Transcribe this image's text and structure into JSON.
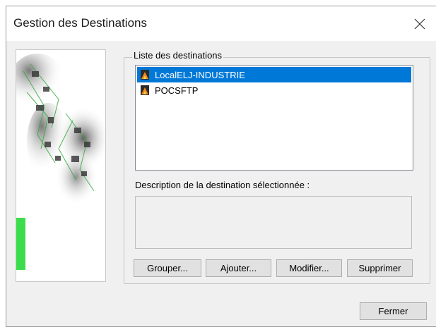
{
  "window": {
    "title": "Gestion des Destinations",
    "close_icon": "close-icon"
  },
  "destinations": {
    "legend": "Liste des destinations",
    "items": [
      {
        "label": "LocalELJ-INDUSTRIE",
        "selected": true,
        "icon": "destination-icon"
      },
      {
        "label": "POCSFTP",
        "selected": false,
        "icon": "destination-icon"
      }
    ],
    "description_label": "Description de la destination sélectionnée :",
    "description_value": ""
  },
  "buttons": {
    "grouper": "Grouper...",
    "ajouter": "Ajouter...",
    "modifier": "Modifier...",
    "supprimer": "Supprimer",
    "fermer": "Fermer"
  },
  "colors": {
    "selection": "#0078d7",
    "side_bar_accent": "#3ddc4d"
  }
}
